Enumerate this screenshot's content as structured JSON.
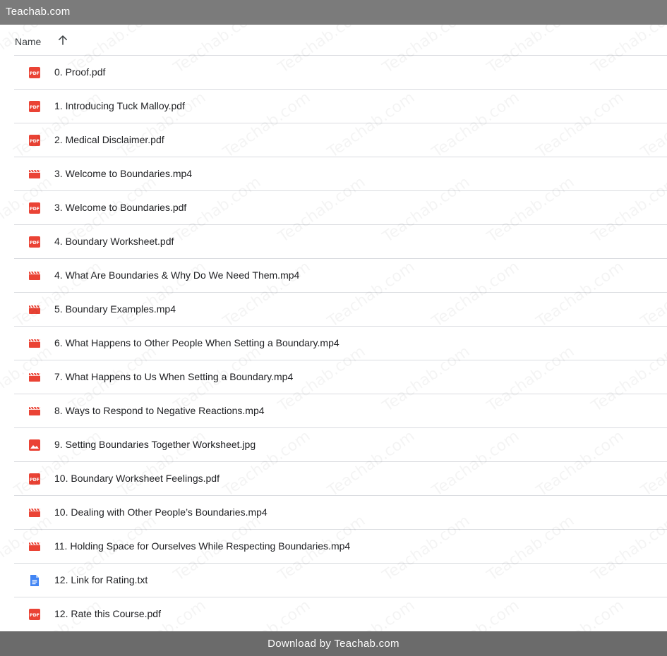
{
  "topbar": {
    "site": "Teachab.com"
  },
  "header": {
    "name_label": "Name",
    "sort_icon": "arrow-up-icon"
  },
  "colors": {
    "pdf": "#ea4335",
    "video": "#ea4335",
    "image": "#ea4335",
    "doc": "#4285f4",
    "topbar": "#7b7b7b",
    "footer": "#6b6b6b"
  },
  "files": [
    {
      "name": "0. Proof.pdf",
      "type": "pdf"
    },
    {
      "name": "1. Introducing Tuck Malloy.pdf",
      "type": "pdf"
    },
    {
      "name": "2. Medical Disclaimer.pdf",
      "type": "pdf"
    },
    {
      "name": "3. Welcome to Boundaries.mp4",
      "type": "video"
    },
    {
      "name": "3. Welcome to Boundaries.pdf",
      "type": "pdf"
    },
    {
      "name": "4. Boundary Worksheet.pdf",
      "type": "pdf"
    },
    {
      "name": "4. What Are Boundaries & Why Do We Need Them.mp4",
      "type": "video"
    },
    {
      "name": "5. Boundary Examples.mp4",
      "type": "video"
    },
    {
      "name": "6. What Happens to Other People When Setting a Boundary.mp4",
      "type": "video"
    },
    {
      "name": "7. What Happens to Us When Setting a Boundary.mp4",
      "type": "video"
    },
    {
      "name": "8. Ways to Respond to Negative Reactions.mp4",
      "type": "video"
    },
    {
      "name": "9. Setting Boundaries Together Worksheet.jpg",
      "type": "image"
    },
    {
      "name": "10. Boundary Worksheet Feelings.pdf",
      "type": "pdf"
    },
    {
      "name": "10. Dealing with Other People’s Boundaries.mp4",
      "type": "video"
    },
    {
      "name": "11. Holding Space for Ourselves While Respecting Boundaries.mp4",
      "type": "video"
    },
    {
      "name": "12. Link for Rating.txt",
      "type": "doc"
    },
    {
      "name": "12. Rate this Course.pdf",
      "type": "pdf"
    }
  ],
  "watermark": "Teachab.com",
  "footer": {
    "download_label": "Download by Teachab.com"
  }
}
